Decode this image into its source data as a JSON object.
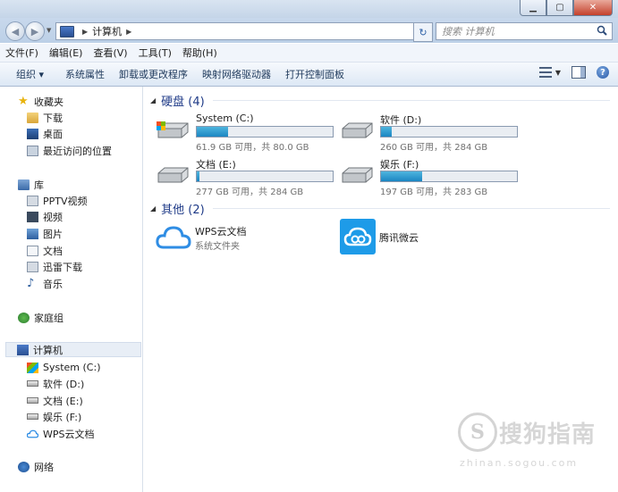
{
  "address": {
    "breadcrumb": [
      "计算机"
    ],
    "search_placeholder": "搜索 计算机"
  },
  "menu": [
    "文件(F)",
    "编辑(E)",
    "查看(V)",
    "工具(T)",
    "帮助(H)"
  ],
  "toolbar": {
    "organize": "组织 ▾",
    "items": [
      "系统属性",
      "卸载或更改程序",
      "映射网络驱动器",
      "打开控制面板"
    ]
  },
  "sidebar": {
    "favorites": "收藏夹",
    "fav_items": [
      "下载",
      "桌面",
      "最近访问的位置"
    ],
    "libraries": "库",
    "lib_items": [
      "PPTV视频",
      "视频",
      "图片",
      "文档",
      "迅雷下载",
      "音乐"
    ],
    "homegroup": "家庭组",
    "computer": "计算机",
    "computer_items": [
      "System (C:)",
      "软件 (D:)",
      "文档 (E:)",
      "娱乐 (F:)",
      "WPS云文档"
    ],
    "network": "网络"
  },
  "main": {
    "drives_header": "硬盘 (4)",
    "drives": [
      {
        "name": "System (C:)",
        "info": "61.9 GB 可用，共 80.0 GB",
        "used_fraction": 0.23
      },
      {
        "name": "软件 (D:)",
        "info": "260 GB 可用，共 284 GB",
        "used_fraction": 0.08
      },
      {
        "name": "文档 (E:)",
        "info": "277 GB 可用，共 284 GB",
        "used_fraction": 0.02
      },
      {
        "name": "娱乐 (F:)",
        "info": "197 GB 可用，共 283 GB",
        "used_fraction": 0.3
      }
    ],
    "other_header": "其他 (2)",
    "others": [
      {
        "name": "WPS云文档",
        "sub": "系统文件夹"
      },
      {
        "name": "腾讯微云"
      }
    ]
  },
  "watermark": {
    "logo_letter": "S",
    "text": "搜狗指南",
    "url": "zhinan.sogou.com"
  }
}
